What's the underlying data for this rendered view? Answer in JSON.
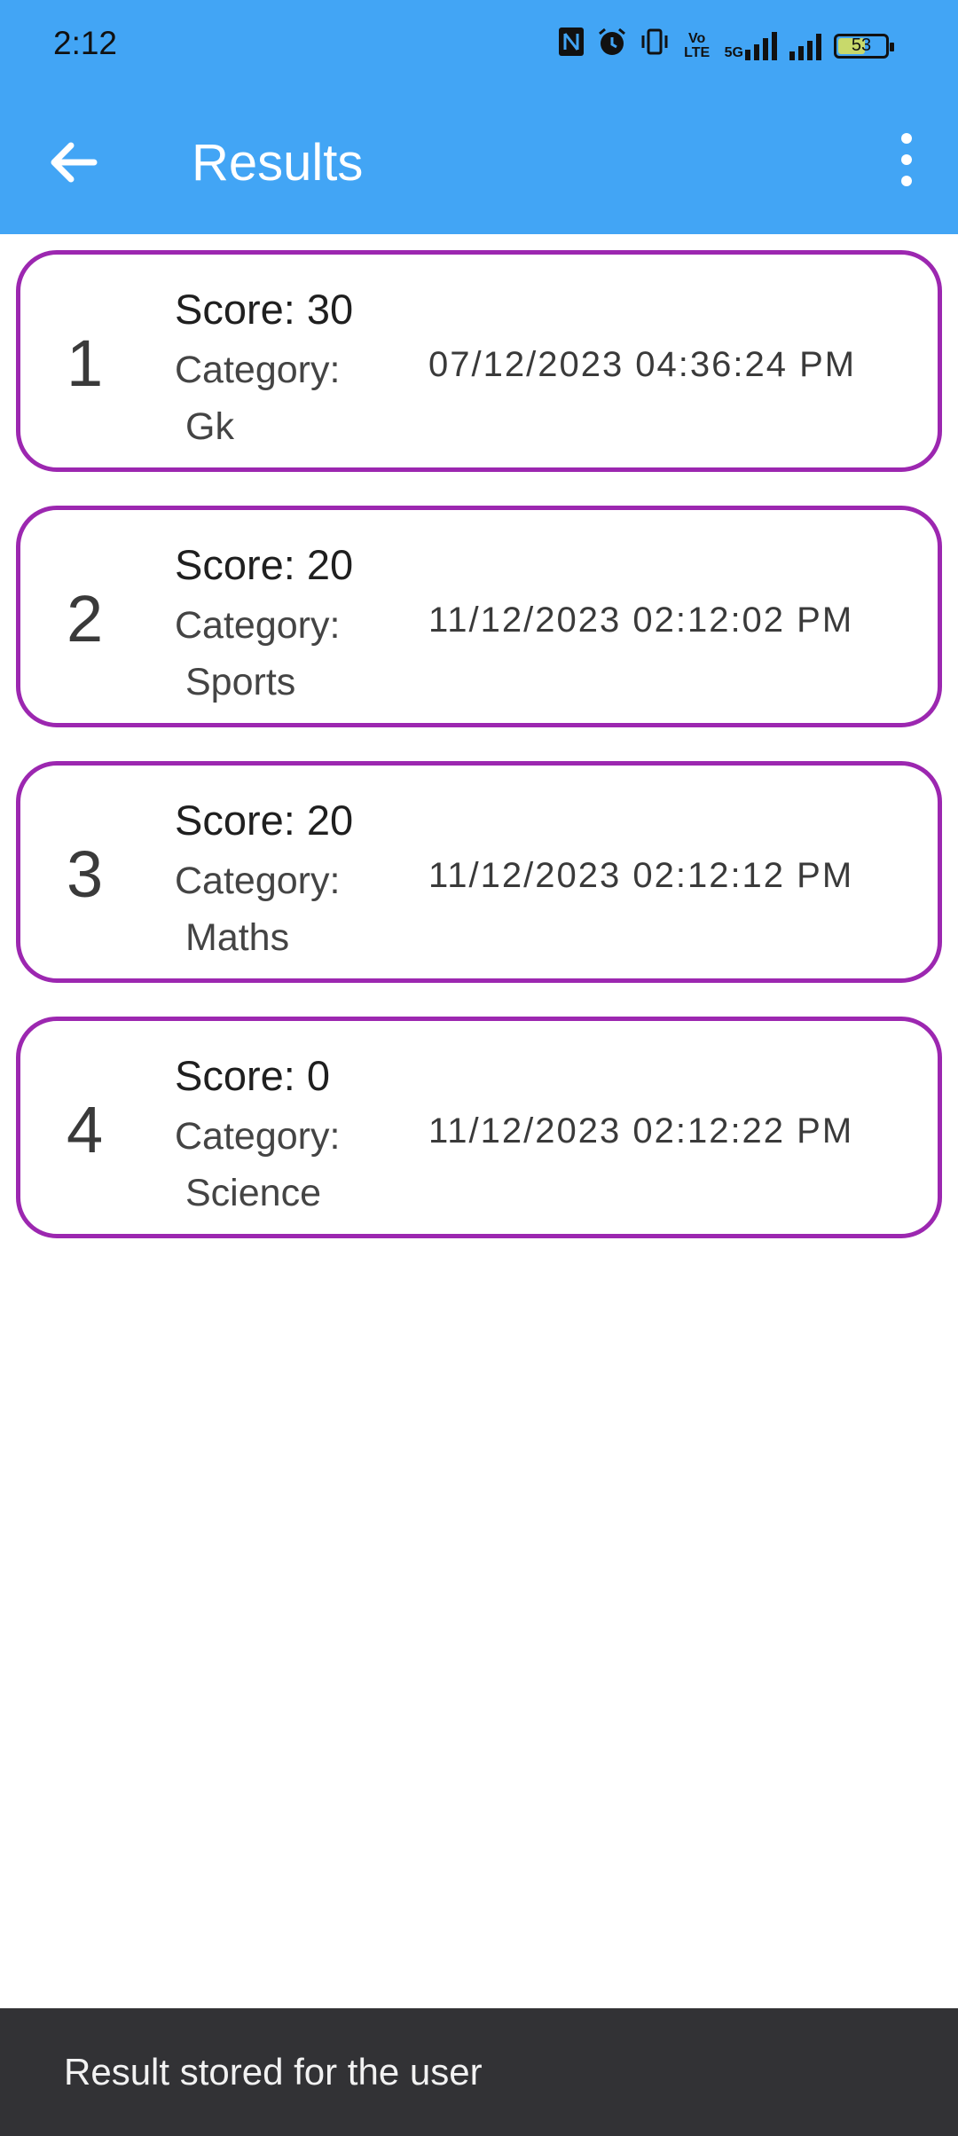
{
  "status_bar": {
    "time": "2:12",
    "battery_level": "53",
    "network_label": "5G",
    "volte_label": "Vo LTE"
  },
  "appbar": {
    "title": "Results",
    "color": "#42a5f5"
  },
  "results": [
    {
      "rank": "1",
      "score": "Score: 30",
      "category_label": "Category:",
      "category": "Gk",
      "datetime": "07/12/2023 04:36:24 PM"
    },
    {
      "rank": "2",
      "score": "Score: 20",
      "category_label": "Category:",
      "category": "Sports",
      "datetime": "11/12/2023 02:12:02 PM"
    },
    {
      "rank": "3",
      "score": "Score: 20",
      "category_label": "Category:",
      "category": "Maths",
      "datetime": "11/12/2023 02:12:12 PM"
    },
    {
      "rank": "4",
      "score": "Score: 0",
      "category_label": "Category:",
      "category": "Science",
      "datetime": "11/12/2023 02:12:22 PM"
    }
  ],
  "card_border_color": "#9c27b0",
  "snackbar": {
    "message": "Result stored for the user"
  }
}
